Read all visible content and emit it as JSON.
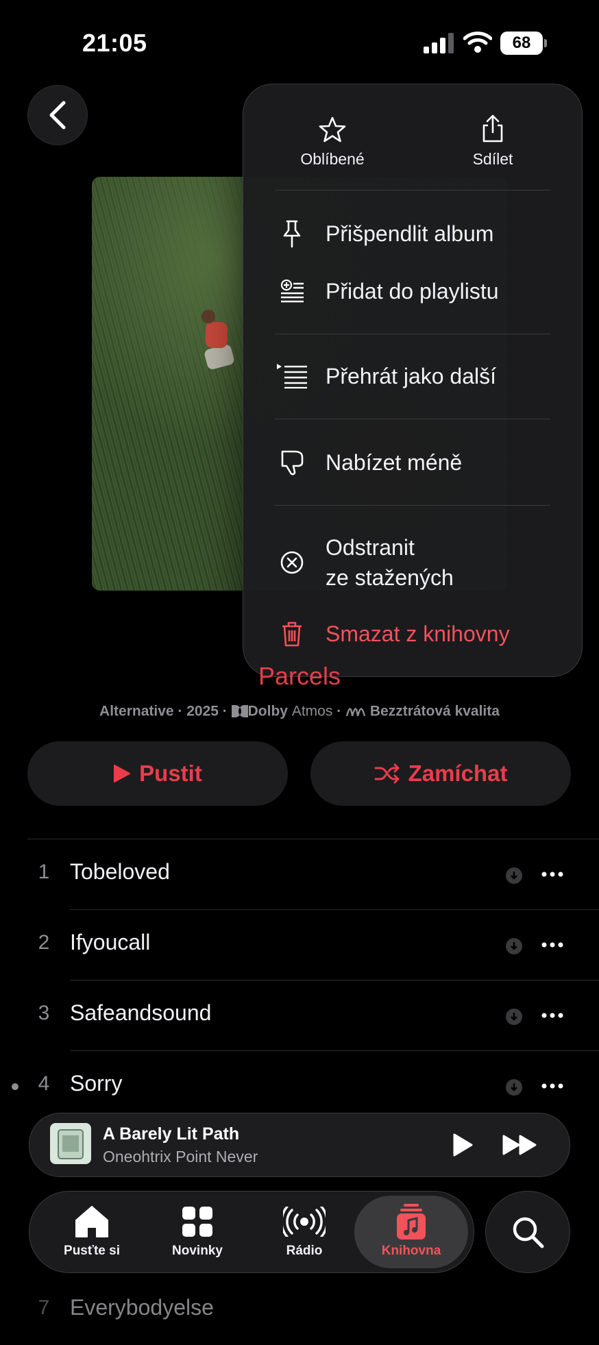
{
  "status_bar": {
    "time": "21:05",
    "battery": "68"
  },
  "menu": {
    "top_actions": [
      {
        "label": "Oblíbené",
        "icon": "star-icon"
      },
      {
        "label": "Sdílet",
        "icon": "share-icon"
      }
    ],
    "items": [
      {
        "label": "Přišpendlit album",
        "icon": "pin-icon"
      },
      {
        "label": "Přidat do playlistu",
        "icon": "add-to-playlist-icon"
      },
      {
        "label": "Přehrát jako další",
        "icon": "play-next-icon"
      },
      {
        "label": "Nabízet méně",
        "icon": "thumbs-down-icon"
      },
      {
        "label_line1": "Odstranit",
        "label_line2": "ze stažených",
        "icon": "remove-download-icon"
      },
      {
        "label": "Smazat z knihovny",
        "icon": "trash-icon",
        "color": "#f3525a"
      }
    ]
  },
  "album": {
    "artist": "Parcels",
    "genre_year": "Alternative · 2025 ·",
    "dolby_bold": "Dolby",
    "dolby_atmos": "Atmos",
    "separator": "·",
    "lossless": "Bezztrátová kvalita"
  },
  "buttons": {
    "play": "Pustit",
    "shuffle": "Zamíchat"
  },
  "tracks": [
    {
      "number": "1",
      "title": "Tobeloved"
    },
    {
      "number": "2",
      "title": "Ifyoucall"
    },
    {
      "number": "3",
      "title": "Safeandsound"
    },
    {
      "number": "4",
      "title": "Sorry"
    },
    {
      "number": "7",
      "title": "Everybodyelse"
    }
  ],
  "mini_player": {
    "title": "A Barely Lit Path",
    "artist": "Oneohtrix Point Never"
  },
  "tabs": [
    {
      "label": "Pusťte si",
      "icon": "home-icon"
    },
    {
      "label": "Novinky",
      "icon": "grid-icon"
    },
    {
      "label": "Rádio",
      "icon": "radio-icon"
    },
    {
      "label": "Knihovna",
      "icon": "library-icon",
      "active": true
    }
  ],
  "colors": {
    "accent": "#e93d4a",
    "danger": "#f3525a",
    "background": "#000000"
  }
}
